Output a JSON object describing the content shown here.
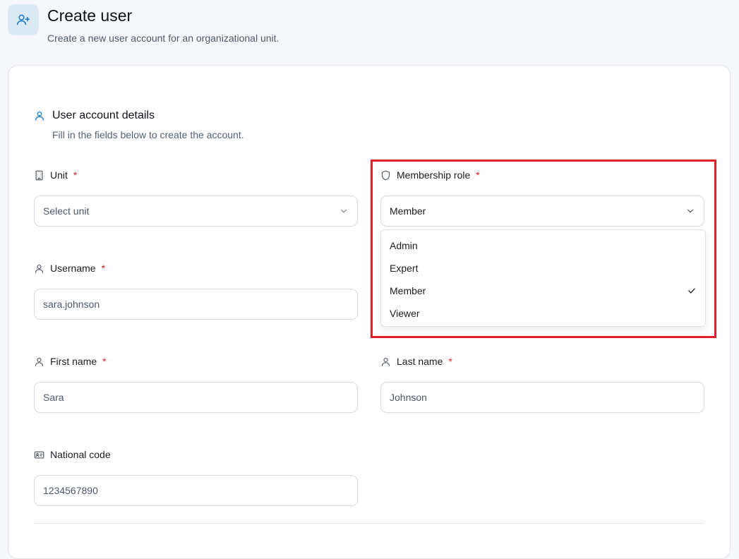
{
  "header": {
    "title": "Create user",
    "subtitle": "Create a new user account for an organizational unit."
  },
  "section": {
    "title": "User account details",
    "subtitle": "Fill in the fields below to create the account."
  },
  "fields": {
    "unit": {
      "label": "Unit",
      "required": "*",
      "placeholder": "Select unit"
    },
    "role": {
      "label": "Membership role",
      "required": "*",
      "value": "Member"
    },
    "username": {
      "label": "Username",
      "required": "*",
      "value": "sara.johnson"
    },
    "first_name": {
      "label": "First name",
      "required": "*",
      "value": "Sara"
    },
    "last_name": {
      "label": "Last name",
      "required": "*",
      "value": "Johnson"
    },
    "national_code": {
      "label": "National code",
      "value": "1234567890"
    }
  },
  "role_options": [
    "Admin",
    "Expert",
    "Member",
    "Viewer"
  ],
  "role_selected": "Member",
  "colors": {
    "accent": "#1677c8",
    "required": "#e0202a",
    "highlight": "#e01e26"
  }
}
